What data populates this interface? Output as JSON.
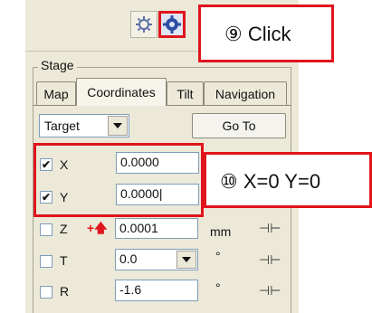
{
  "toolbar": {
    "stage_icon": "gear-icon",
    "coords_icon": "blue-cog-icon"
  },
  "callouts": {
    "click": "⑨ Click",
    "set_xy": "⑩ X=0 Y=0"
  },
  "group": {
    "title": "Stage"
  },
  "tabs": [
    {
      "label": "Map"
    },
    {
      "label": "Coordinates"
    },
    {
      "label": "Tilt"
    },
    {
      "label": "Navigation"
    }
  ],
  "target_combo": {
    "value": "Target"
  },
  "goto_button": {
    "label": "Go To"
  },
  "axes": [
    {
      "label": "X",
      "checked": "✔",
      "value": "0.0000"
    },
    {
      "label": "Y",
      "checked": "✔",
      "value": "0.0000|"
    },
    {
      "label": "Z",
      "value": "0.0001",
      "unit": "mm"
    },
    {
      "label": "T",
      "value": "0.0",
      "unit": "°"
    },
    {
      "label": "R",
      "value": "-1.6",
      "unit": "°"
    }
  ],
  "colors": {
    "highlight": "#e0141c",
    "panel": "#ece9d8"
  }
}
